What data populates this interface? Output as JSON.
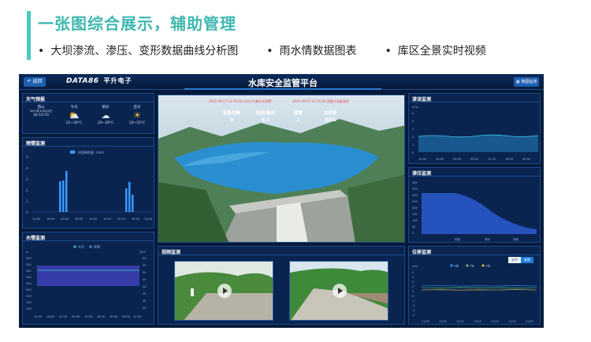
{
  "header": {
    "title": "一张图综合展示，辅助管理",
    "bullets": [
      "大坝渗流、渗压、变形数据曲线分析图",
      "雨水情数据图表",
      "库区全景实时视频"
    ],
    "bullet_mark": "•"
  },
  "dashboard": {
    "back_label": "返回",
    "brand": "DATA86",
    "brand_sub": "平升电子",
    "title": "水库安全监管平台",
    "home_label": "地图监测",
    "weather": {
      "title": "天气预报",
      "days": [
        {
          "label": "西山",
          "date": "2021年12月14日",
          "time": "16:10:35",
          "icon": "partly-cloudy-icon"
        },
        {
          "label": "今天",
          "desc": "21~30℃",
          "icon": "partly-cloudy-icon"
        },
        {
          "label": "明天",
          "desc": "20~28℃",
          "icon": "cloud-icon"
        },
        {
          "label": "后天",
          "desc": "19~25℃",
          "icon": "sun-icon"
        }
      ]
    },
    "rain": {
      "title": "雨情监测",
      "legend": "时段降雨量（mm）",
      "yticks": [
        "5",
        "4",
        "3",
        "2",
        "1",
        "0"
      ],
      "xticks": [
        "12:00",
        "18:00",
        "00:00",
        "06:00",
        "12:00",
        "18:00",
        "00:00",
        "06:00",
        "12:00"
      ]
    },
    "water": {
      "title": "水情监测",
      "legend": [
        "水位",
        "库容"
      ],
      "yunit_left": "m",
      "yunit_right": "万m³",
      "yticks_left": [
        "500",
        "450",
        "400",
        "350",
        "300",
        "250",
        "200",
        "150",
        "100"
      ],
      "yticks_right": [
        "60",
        "55",
        "50",
        "45",
        "40",
        "35",
        "30",
        "25"
      ],
      "xticks": [
        "12:00",
        "18:00",
        "00:00",
        "06:00",
        "12:00",
        "18:00",
        "00:00",
        "06:00",
        "12:00"
      ]
    },
    "scene": {
      "alerts": [
        "2021-09-07 14:35:00  水位计为降水位预警",
        "2021-09-07 14:35:00  测量计设备离线"
      ],
      "stats": [
        {
          "label": "设备总数",
          "value": "9"
        },
        {
          "label": "在线/离线",
          "value": "8/1"
        },
        {
          "label": "报警",
          "value": "1"
        },
        {
          "label": "在线率",
          "value": "89%"
        }
      ]
    },
    "video": {
      "title": "视频监测"
    },
    "seepage_flow": {
      "title": "渗流监测",
      "yunit": "m³/s",
      "yticks": [
        "5",
        "4",
        "3",
        "2",
        "1",
        "0"
      ],
      "xticks": [
        "12:00",
        "18:00",
        "00:00",
        "06:00",
        "12:00",
        "18:00",
        "00:00"
      ]
    },
    "seepage_pressure": {
      "title": "渗压监测",
      "yticks": [
        "400",
        "350",
        "300",
        "250",
        "200",
        "150",
        "100",
        "50",
        "0"
      ],
      "xticks": [
        "坝顶",
        "坝中",
        "坝底"
      ]
    },
    "displacement": {
      "title": "位移监测",
      "toggle": [
        "水平",
        "垂直"
      ],
      "legend": [
        "X轴",
        "Y轴",
        "Z轴"
      ],
      "yunit": "mm",
      "yticks": [
        "5",
        "4",
        "3",
        "2",
        "1",
        "0",
        "-1",
        "-2",
        "-3",
        "-4"
      ],
      "xticks": [
        "11/20",
        "11/21",
        "11/21",
        "11/22",
        "11/22",
        "11/23",
        "11/23"
      ]
    }
  }
}
